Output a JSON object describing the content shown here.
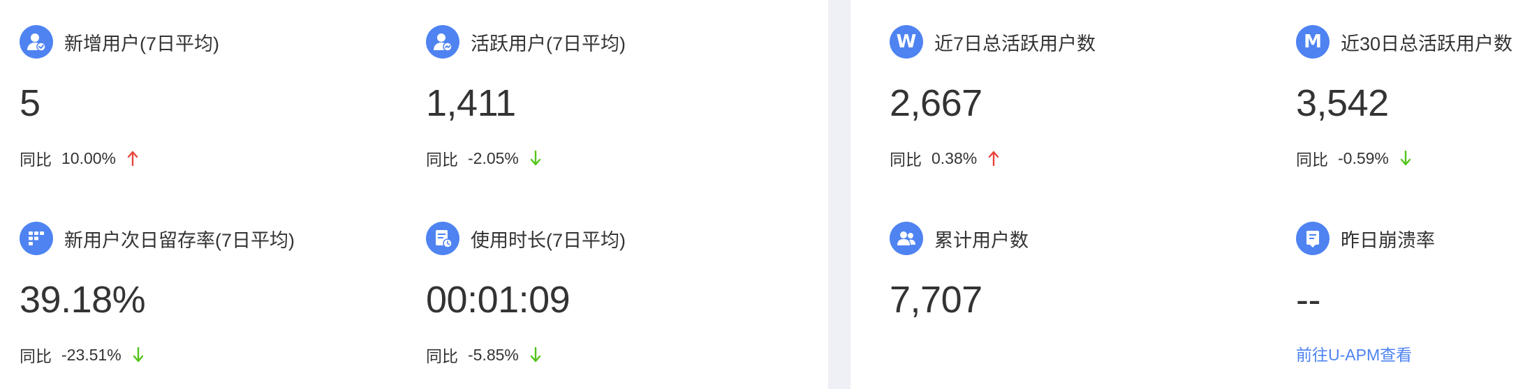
{
  "colors": {
    "accent": "#4e83f1",
    "up": "#e8453c",
    "down": "#52c41a",
    "divider": "#eef0f5"
  },
  "cards": [
    {
      "title": "新增用户(7日平均)",
      "value": "5",
      "compare_label": "同比",
      "compare_pct": "10.00%",
      "trend": "up",
      "icon": "user-add-icon"
    },
    {
      "title": "活跃用户(7日平均)",
      "value": "1,411",
      "compare_label": "同比",
      "compare_pct": "-2.05%",
      "trend": "down",
      "icon": "active-user-icon"
    },
    {
      "title": "新用户次日留存率(7日平均)",
      "value": "39.18%",
      "compare_label": "同比",
      "compare_pct": "-23.51%",
      "trend": "down",
      "icon": "retention-grid-icon"
    },
    {
      "title": "使用时长(7日平均)",
      "value": "00:01:09",
      "compare_label": "同比",
      "compare_pct": "-5.85%",
      "trend": "down",
      "icon": "duration-doc-clock-icon"
    },
    {
      "title": "近7日总活跃用户数",
      "value": "2,667",
      "compare_label": "同比",
      "compare_pct": "0.38%",
      "trend": "up",
      "icon": "w-letter-icon",
      "icon_letter": "W"
    },
    {
      "title": "近30日总活跃用户数",
      "value": "3,542",
      "compare_label": "同比",
      "compare_pct": "-0.59%",
      "trend": "down",
      "icon": "m-letter-icon",
      "icon_letter": "M"
    },
    {
      "title": "累计用户数",
      "value": "7,707",
      "icon": "users-group-icon"
    },
    {
      "title": "昨日崩溃率",
      "value": "--",
      "link": "前往U-APM查看",
      "icon": "crash-report-icon"
    }
  ]
}
